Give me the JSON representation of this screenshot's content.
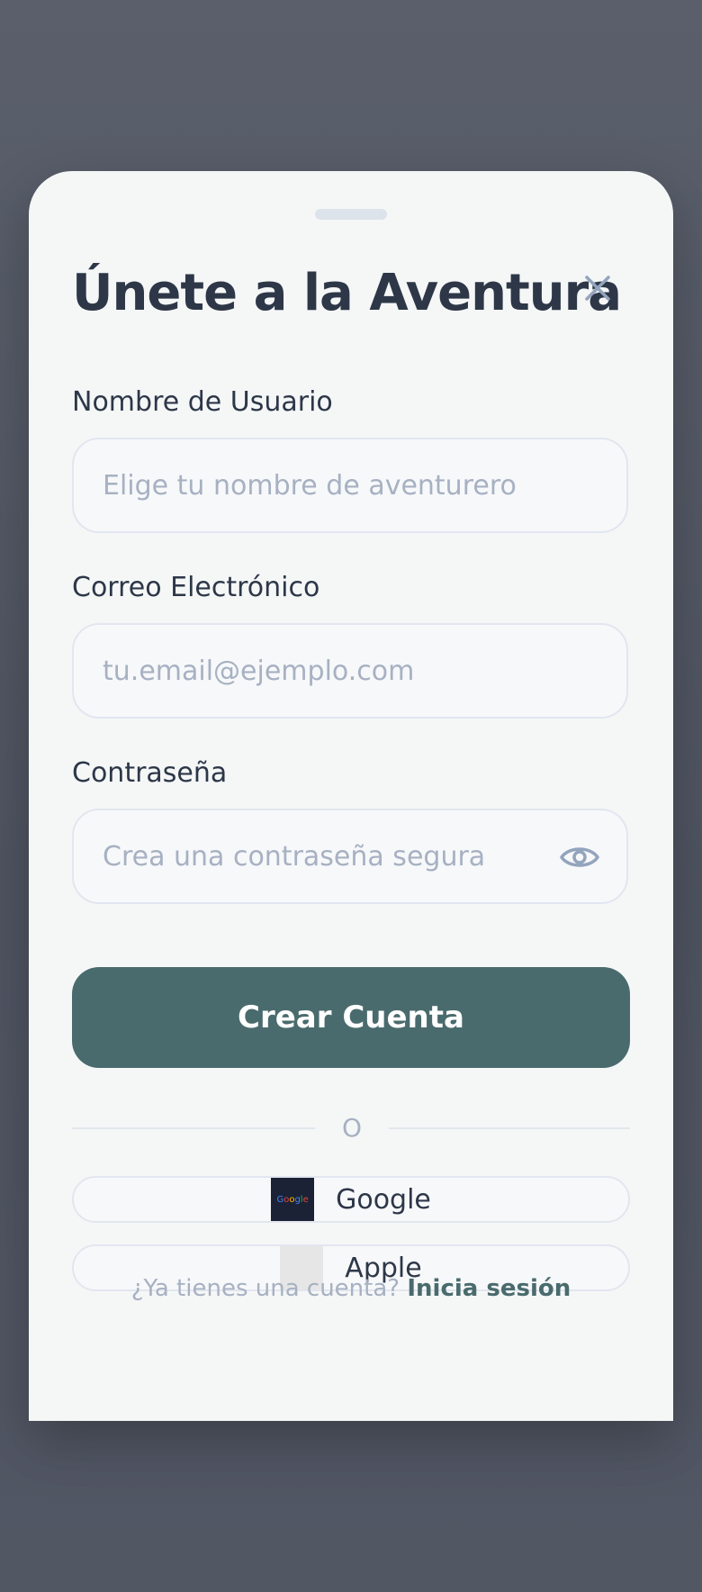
{
  "sheet": {
    "title": "Únete a la Aventura"
  },
  "form": {
    "username": {
      "label": "Nombre de Usuario",
      "placeholder": "Elige tu nombre de aventurero",
      "value": ""
    },
    "email": {
      "label": "Correo Electrónico",
      "placeholder": "tu.email@ejemplo.com",
      "value": ""
    },
    "password": {
      "label": "Contraseña",
      "placeholder": "Crea una contraseña segura",
      "value": ""
    },
    "submit_label": "Crear Cuenta"
  },
  "divider": {
    "text": "O"
  },
  "social": {
    "google": {
      "label": "Google",
      "logo_text": "Google"
    },
    "apple": {
      "label": "Apple"
    }
  },
  "footer": {
    "prompt": "¿Ya tienes una cuenta?",
    "link": "Inicia sesión"
  },
  "icons": {
    "close": "close-icon",
    "visibility": "eye-icon"
  },
  "colors": {
    "accent": "#4a6b6d",
    "title": "#2d3748",
    "placeholder": "#a7b1c2",
    "sheet_bg": "#f5f7f7",
    "overlay_bg": "#555a66"
  }
}
